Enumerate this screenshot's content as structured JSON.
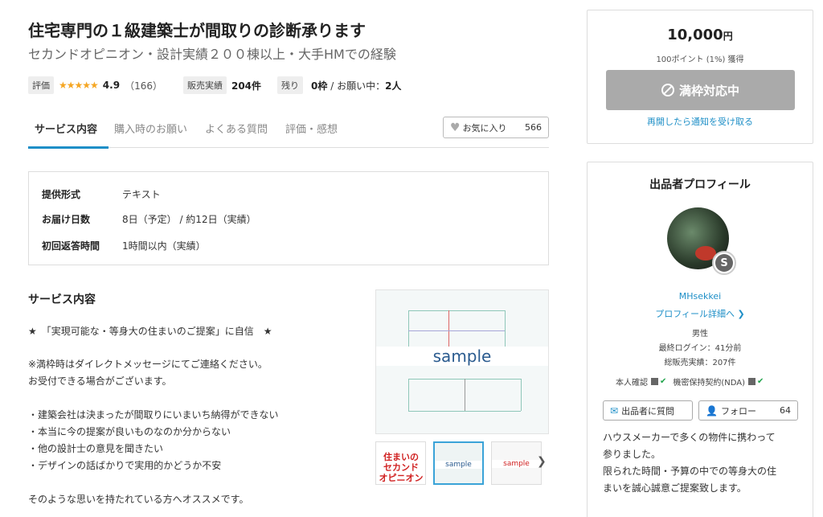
{
  "header": {
    "title": "住宅専門の１級建築士が間取りの診断承ります",
    "subtitle": "セカンドオピニオン・設計実績２００棟以上・大手HMでの経験"
  },
  "meta": {
    "rating_tag": "評価",
    "stars": "★★★★★",
    "rating_value": "4.9",
    "rating_count": "（166）",
    "sales_tag": "販売実績",
    "sales_value": "204件",
    "remaining_tag": "残り",
    "remaining_value": "0枠",
    "requesting_text": " / お願い中：",
    "requesting_value": "2人"
  },
  "tabs": [
    {
      "label": "サービス内容"
    },
    {
      "label": "購入時のお願い"
    },
    {
      "label": "よくある質問"
    },
    {
      "label": "評価・感想"
    }
  ],
  "favorite": {
    "label": "お気に入り",
    "count": "566"
  },
  "info": [
    {
      "key": "提供形式",
      "value": "テキスト"
    },
    {
      "key": "お届け日数",
      "value": "8日（予定） / 約12日（実績）"
    },
    {
      "key": "初回返答時間",
      "value": "1時間以内（実績）"
    }
  ],
  "service": {
    "title": "サービス内容",
    "lines": [
      "★　「実現可能な・等身大の住まいのご提案」に自信　★",
      "※満枠時はダイレクトメッセージにてご連絡ください。",
      "お受付できる場合がございます。",
      "・建築会社は決まったが間取りにいまいち納得ができない",
      "・本当に今の提案が良いものなのか分からない",
      "・他の設計士の意見を聞きたい",
      "・デザインの話ばかりで実用的かどうか不安",
      "そのような思いを持たれている方へオススメです。"
    ]
  },
  "gallery": {
    "main_label": "sample",
    "thumb1_lines": [
      "住まいの",
      "セカンド",
      "オピニオン"
    ],
    "thumb2_label": "sample",
    "thumb3_label": "sample"
  },
  "purchase": {
    "price": "10,000",
    "currency": "円",
    "points": "100ポイント (1%) 獲得",
    "full_button": "満枠対応中",
    "notify_link": "再開したら通知を受け取る"
  },
  "profile": {
    "title": "出品者プロフィール",
    "badge": "S",
    "name": "MHsekkei",
    "detail_link": "プロフィール詳細へ",
    "gender": "男性",
    "last_login": "最終ログイン：41分前",
    "total_sales": "総販売実績：207件",
    "identity": "本人確認",
    "nda": "機密保持契約(NDA)",
    "ask_button": "出品者に質問",
    "follow_button": "フォロー",
    "follow_count": "64",
    "intro_lines": [
      "ハウスメーカーで多くの物件に携わって",
      "参りました。",
      "限られた時間・予算の中での等身大の住",
      "まいを誠心誠意ご提案致します。"
    ]
  }
}
